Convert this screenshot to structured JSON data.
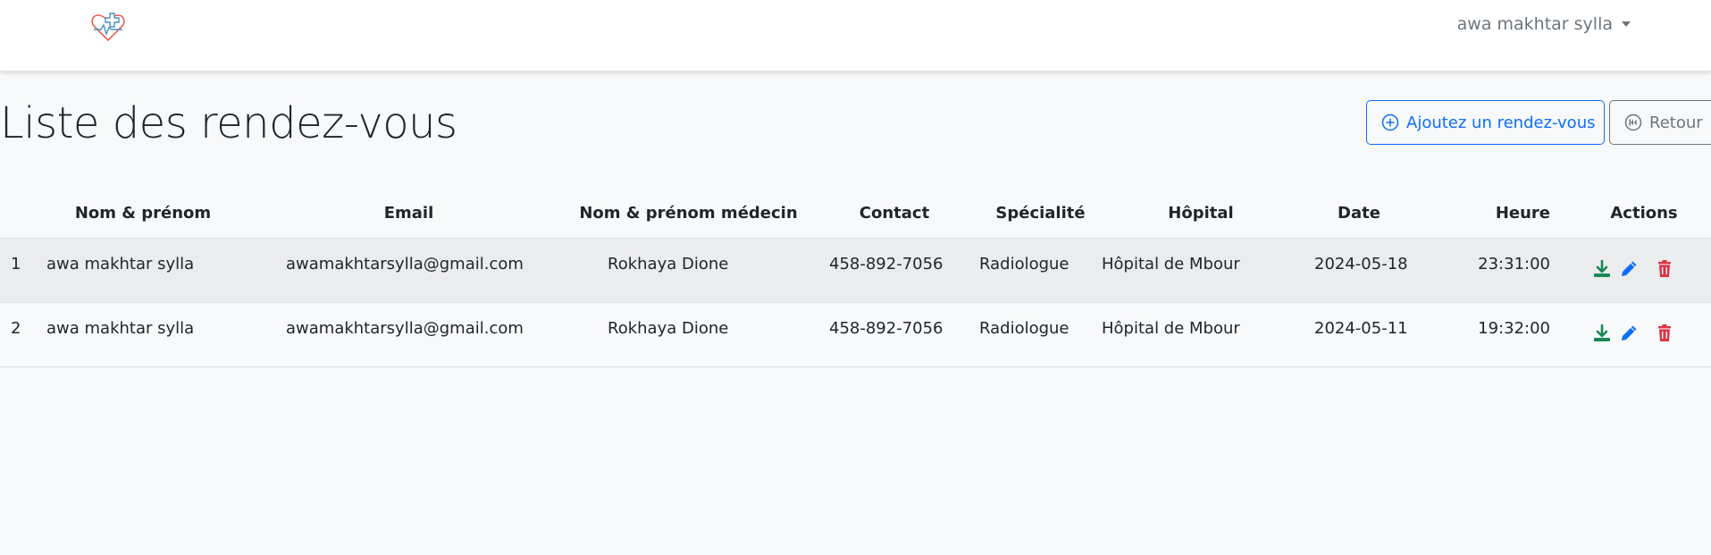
{
  "header": {
    "user_name": "awa makhtar sylla"
  },
  "page": {
    "title": "Liste des rendez-vous",
    "add_button_label": "Ajoutez un rendez-vous",
    "back_button_label": "Retour"
  },
  "table": {
    "columns": [
      "",
      "Nom & prénom",
      "Email",
      "Nom & prénom médecin",
      "Contact",
      "Spécialité",
      "Hôpital",
      "Date",
      "Heure",
      "Actions"
    ],
    "rows": [
      {
        "num": "1",
        "name": "awa makhtar sylla",
        "email": "awamakhtarsylla@gmail.com",
        "doctor": "Rokhaya Dione",
        "contact": "458-892-7056",
        "specialty": "Radiologue",
        "hospital": "Hôpital de Mbour",
        "date": "2024-05-18",
        "time": "23:31:00"
      },
      {
        "num": "2",
        "name": "awa makhtar sylla",
        "email": "awamakhtarsylla@gmail.com",
        "doctor": "Rokhaya Dione",
        "contact": "458-892-7056",
        "specialty": "Radiologue",
        "hospital": "Hôpital de Mbour",
        "date": "2024-05-11",
        "time": "19:32:00"
      }
    ],
    "row_actions": [
      "download-icon",
      "edit-pencil-icon",
      "trash-icon"
    ]
  },
  "colors": {
    "primary": "#0d6efd",
    "secondary": "#6c757d",
    "success": "#198754",
    "danger": "#dc3545"
  }
}
